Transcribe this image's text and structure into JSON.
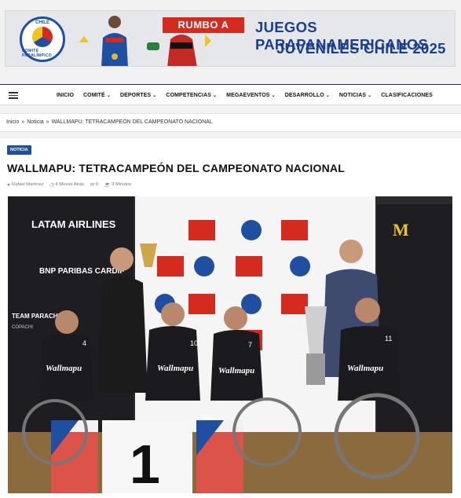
{
  "banner": {
    "logo_top": "CHILE",
    "logo_bottom": "COMITÉ PARALÍMPICO",
    "rumbo": "RUMBO A",
    "title_line1": "JUEGOS PARAPANAMERICANOS",
    "title_line2": "JUVENILES CHILE 2025"
  },
  "nav": {
    "items": [
      {
        "label": "INICIO",
        "dropdown": false
      },
      {
        "label": "COMITÉ",
        "dropdown": true
      },
      {
        "label": "DEPORTES",
        "dropdown": true
      },
      {
        "label": "COMPETENCIAS",
        "dropdown": true
      },
      {
        "label": "MEGAEVENTOS",
        "dropdown": true
      },
      {
        "label": "DESARROLLO",
        "dropdown": true
      },
      {
        "label": "NOTICIAS",
        "dropdown": true
      },
      {
        "label": "CLASIFICACIONES",
        "dropdown": false
      }
    ]
  },
  "breadcrumb": {
    "home": "Inicio",
    "section": "Noticia",
    "current": "WALLMAPU: TETRACAMPEÓN DEL CAMPEONATO NACIONAL",
    "separator": "»"
  },
  "article": {
    "category": "NOTICIA",
    "title": "WALLMAPU: TETRACAMPEÓN DEL CAMPEONATO NACIONAL",
    "author": "Rafael Martínez",
    "date": "4 Meses Atrás",
    "comments": "0",
    "read_time": "3 Minutos"
  },
  "photo": {
    "sponsors": [
      "LATAM AIRLINES",
      "BNP PARIBAS CARDIF",
      "TEAM PARACHILE",
      "COPACHI"
    ],
    "jersey_text": "Wallmapu",
    "jersey_numbers": [
      "4",
      "10",
      "7",
      "11"
    ],
    "podium_number": "1"
  },
  "colors": {
    "brand_blue": "#1e4fa0",
    "brand_red": "#d52b1e",
    "nav_border": "#1b2e55"
  }
}
